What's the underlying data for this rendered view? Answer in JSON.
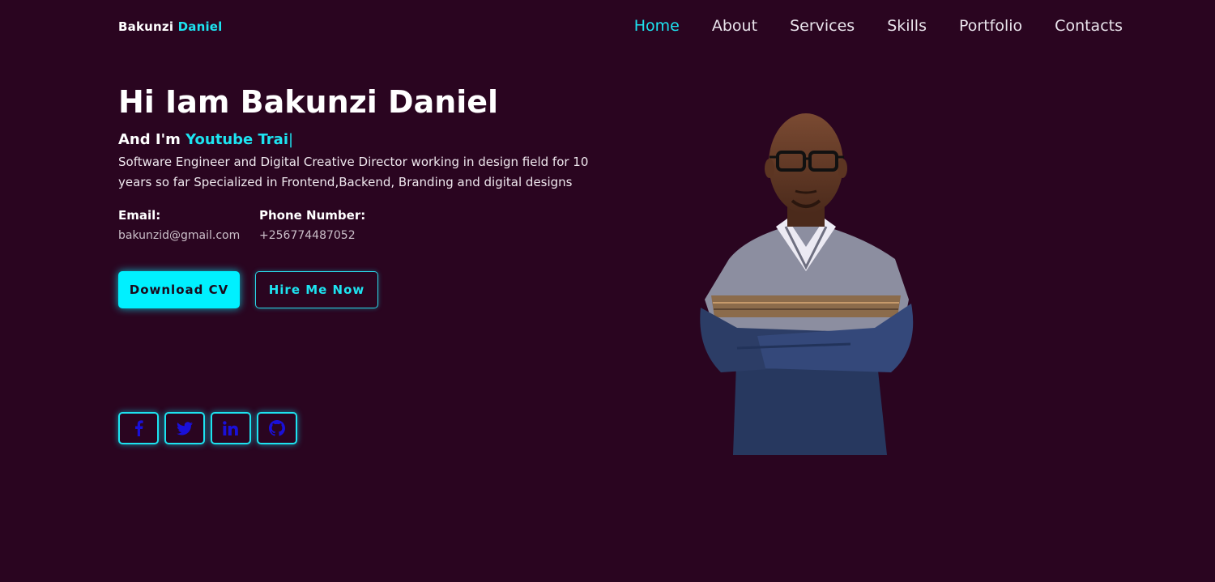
{
  "brand": {
    "first": "Bakunzi",
    "second": "Daniel",
    "accent_color": "#1de3f0"
  },
  "nav": {
    "items": [
      {
        "label": "Home",
        "active": true
      },
      {
        "label": "About",
        "active": false
      },
      {
        "label": "Services",
        "active": false
      },
      {
        "label": "Skills",
        "active": false
      },
      {
        "label": "Portfolio",
        "active": false
      },
      {
        "label": "Contacts",
        "active": false
      }
    ]
  },
  "hero": {
    "title": "Hi Iam Bakunzi Daniel",
    "sub_prefix": "And I'm",
    "typed_text": "Youtube Trai",
    "caret": "|",
    "description": "Software Engineer and Digital Creative Director working in design field for 10 years so far Specialized in Frontend,Backend, Branding and digital designs",
    "email_label": "Email:",
    "email_value": "bakunzid@gmail.com",
    "phone_label": "Phone Number:",
    "phone_value": "+256774487052",
    "primary_button": "Download CV",
    "secondary_button": "Hire Me Now"
  },
  "socials": [
    {
      "icon": "facebook-icon"
    },
    {
      "icon": "twitter-icon"
    },
    {
      "icon": "linkedin-icon"
    },
    {
      "icon": "github-icon"
    }
  ],
  "colors": {
    "background": "#2a0520",
    "accent": "#1de3f0",
    "button_fill": "#00f0ff",
    "social_icon": "#1a10d8"
  }
}
